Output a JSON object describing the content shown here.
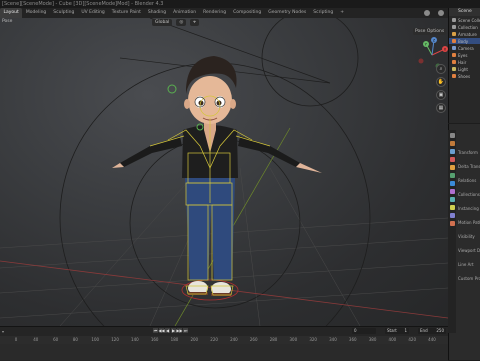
{
  "window": {
    "title": "[Scene][SceneMode] - Cube [3D][SceneMode]Mod] - Blender 4.3"
  },
  "workspace_tabs": [
    {
      "label": "Layout",
      "active": true
    },
    {
      "label": "Modeling"
    },
    {
      "label": "Sculpting"
    },
    {
      "label": "UV Editing"
    },
    {
      "label": "Texture Paint"
    },
    {
      "label": "Shading"
    },
    {
      "label": "Animation"
    },
    {
      "label": "Rendering"
    },
    {
      "label": "Compositing"
    },
    {
      "label": "Geometry Nodes"
    },
    {
      "label": "Scripting"
    },
    {
      "label": "+"
    }
  ],
  "viewport": {
    "mode": "Pose",
    "transform_orientation": "Global",
    "pose_options": "Pose Options",
    "gizmo": {
      "x": "X",
      "y": "Y",
      "z": "Z"
    }
  },
  "outliner": {
    "title": "Scene",
    "items": [
      {
        "label": "Scene Collection",
        "color": "#9a9a9a"
      },
      {
        "label": "Collection",
        "color": "#9a9a9a"
      },
      {
        "label": "Armature",
        "color": "#d9a045"
      },
      {
        "label": "Body",
        "color": "#e08040",
        "selected": true
      },
      {
        "label": "Camera",
        "color": "#7a9acc"
      },
      {
        "label": "Eyes",
        "color": "#e08040"
      },
      {
        "label": "Hair",
        "color": "#e08040"
      },
      {
        "label": "Light",
        "color": "#c8b860"
      },
      {
        "label": "Shoes",
        "color": "#e08040"
      }
    ]
  },
  "properties": {
    "tab_colors": [
      "#888",
      "#c07a3a",
      "#6a9fd0",
      "#d05a5a",
      "#e0a040",
      "#56a070",
      "#3a8ad8",
      "#b070d0",
      "#5ab0b0",
      "#d0d050",
      "#8080d0",
      "#d07050"
    ],
    "rows": [
      "Transform",
      "Delta Transform",
      "Relations",
      "Collections",
      "Instancing",
      "Motion Paths",
      "Visibility",
      "Viewport Display",
      "Line Art",
      "Custom Props"
    ]
  },
  "timeline": {
    "start_label": "Start",
    "start": "1",
    "end_label": "End",
    "end": "250",
    "current": "0",
    "ruler": [
      "0",
      "40",
      "60",
      "80",
      "100",
      "120",
      "140",
      "160",
      "180",
      "200",
      "220",
      "240",
      "260",
      "280",
      "300",
      "320",
      "340",
      "360",
      "380",
      "400",
      "420",
      "440"
    ]
  }
}
